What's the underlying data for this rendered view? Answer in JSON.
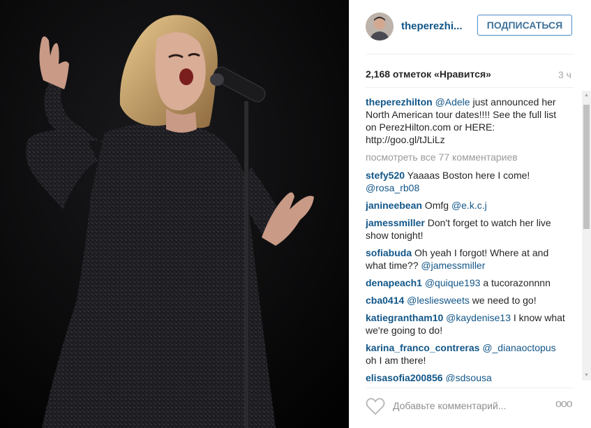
{
  "header": {
    "username": "theperezhi...",
    "follow_label": "ПОДПИСАТЬСЯ"
  },
  "stats": {
    "likes": "2,168 отметок «Нравится»",
    "time": "3 ч"
  },
  "caption": {
    "username": "theperezhilton",
    "mention": "@Adele",
    "text": " just announced her North American tour dates!!!! See the full list on PerezHilton.com or HERE: http://goo.gl/tJLiLz"
  },
  "view_all": "посмотреть все 77 комментариев",
  "comments": [
    {
      "user": "stefy520",
      "before": " Yaaaas Boston here I come! ",
      "mention": "@rosa_rb08",
      "after": ""
    },
    {
      "user": "janineebean",
      "before": " Omfg ",
      "mention": "@e.k.c.j",
      "after": ""
    },
    {
      "user": "jamessmiller",
      "before": " Don't forget to watch her live show tonight!",
      "mention": "",
      "after": ""
    },
    {
      "user": "sofiabuda",
      "before": " Oh yeah I forgot! Where at and what time?? ",
      "mention": "@jamessmiller",
      "after": ""
    },
    {
      "user": "denapeach1",
      "before": " ",
      "mention": "@quique193",
      "after": " a tucorazonnnn"
    },
    {
      "user": "cba0414",
      "before": " ",
      "mention": "@lesliesweets",
      "after": " we need to go!"
    },
    {
      "user": "katiegrantham10",
      "before": " ",
      "mention": "@kaydenise13",
      "after": " I know what we're going to do!"
    },
    {
      "user": "karina_franco_contreras",
      "before": " ",
      "mention": "@_dianaoctopus",
      "after": " oh I am there!"
    },
    {
      "user": "elisasofia200856",
      "before": " ",
      "mention": "@sdsousa",
      "after": ""
    }
  ],
  "footer": {
    "add_comment_placeholder": "Добавьте комментарий...",
    "more_label": "ooo",
    "heart_icon": "heart-outline-icon"
  },
  "colors": {
    "link": "#125688",
    "follow_border": "#4c8cc6",
    "muted": "#999999"
  }
}
